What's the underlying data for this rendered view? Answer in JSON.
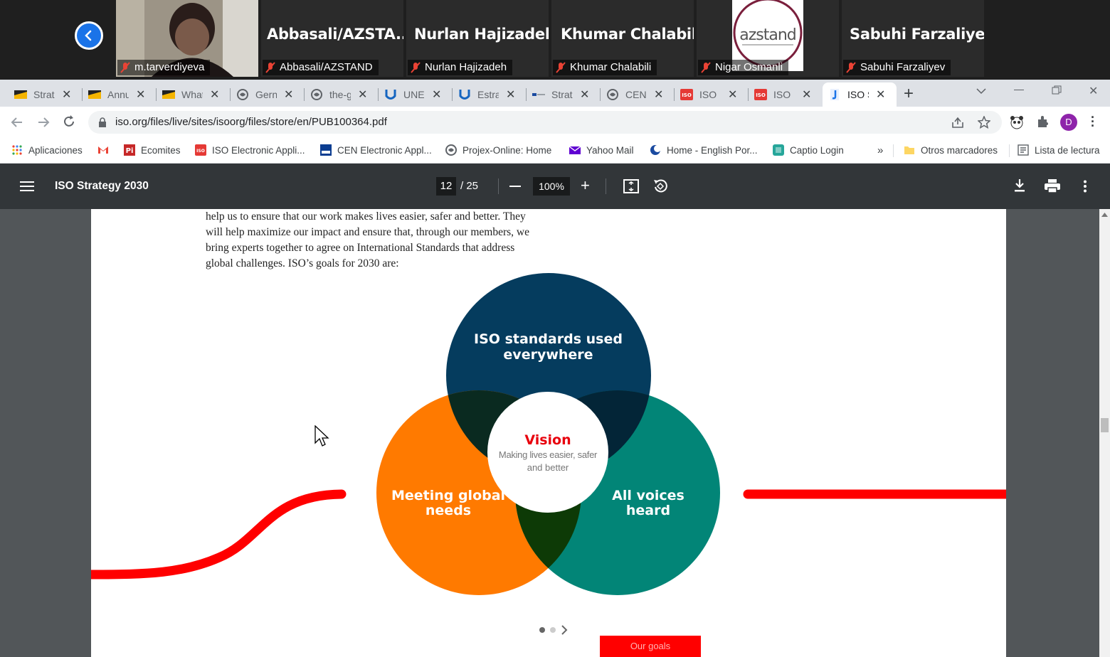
{
  "meeting": {
    "participants": [
      {
        "label": "m.tarverdiyeva",
        "display_name": ""
      },
      {
        "label": "Abbasali/AZSTAND",
        "display_name": "Abbasali/AZSTA..."
      },
      {
        "label": "Nurlan Hajizadeh",
        "display_name": "Nurlan Hajizadeh"
      },
      {
        "label": "Khumar Chalabili",
        "display_name": "Khumar Chalabili"
      },
      {
        "label": "Nigar Osmanli",
        "display_name": ""
      },
      {
        "label": "Sabuhi Farzaliyev",
        "display_name": "Sabuhi Farzaliyev"
      }
    ],
    "logo_text": "azstand"
  },
  "tabs": [
    {
      "title": "Strat",
      "icon": "folder-doc-icon"
    },
    {
      "title": "Annu",
      "icon": "folder-doc-icon"
    },
    {
      "title": "What",
      "icon": "folder-doc-icon"
    },
    {
      "title": "Gern",
      "icon": "globe-icon"
    },
    {
      "title": "the-g",
      "icon": "globe-icon"
    },
    {
      "title": "UNE",
      "icon": "une-icon"
    },
    {
      "title": "Estra",
      "icon": "une-icon"
    },
    {
      "title": "Strat",
      "icon": "dash-icon"
    },
    {
      "title": "CEN",
      "icon": "globe-icon"
    },
    {
      "title": "ISO",
      "icon": "iso-icon"
    },
    {
      "title": "ISO",
      "icon": "iso-icon"
    },
    {
      "title": "ISO S",
      "icon": "j-icon"
    }
  ],
  "address_bar": {
    "url": "iso.org/files/live/sites/isoorg/files/store/en/PUB100364.pdf"
  },
  "profile_initial": "D",
  "bookmarks": [
    {
      "label": "Aplicaciones",
      "icon": "apps-grid-icon"
    },
    {
      "label": "",
      "icon": "gmail-icon"
    },
    {
      "label": "Ecomites",
      "icon": "pi-icon"
    },
    {
      "label": "ISO Electronic Appli...",
      "icon": "iso-icon"
    },
    {
      "label": "CEN Electronic Appl...",
      "icon": "cen-icon"
    },
    {
      "label": "Projex-Online: Home",
      "icon": "globe-icon"
    },
    {
      "label": "Yahoo Mail",
      "icon": "mail-icon"
    },
    {
      "label": "Home - English Por...",
      "icon": "moon-icon"
    },
    {
      "label": "Captio Login",
      "icon": "captio-icon"
    }
  ],
  "bookmarks_overflow": "»",
  "other_bookmarks": "Otros marcadores",
  "reading_list": "Lista de lectura",
  "pdf": {
    "title": "ISO Strategy 2030",
    "page_current": "12",
    "page_total": "/ 25",
    "zoom": "100%"
  },
  "document": {
    "paragraph": [
      "help us to ensure that our work makes lives easier, safer and better. They",
      "will help maximize our impact and ensure that, through our members, we",
      "bring experts together to agree on International Standards that address",
      "global challenges. ISO’s goals for 2030 are:"
    ],
    "venn": {
      "top_line1": "ISO standards used",
      "top_line2": "everywhere",
      "left_line1": "Meeting global",
      "left_line2": "needs",
      "right_line1": "All voices",
      "right_line2": "heard",
      "center_title": "Vision",
      "center_line1": "Making lives easier, safer",
      "center_line2": "and better"
    },
    "goals_button": "Our goals",
    "colors": {
      "top": "#053c5e",
      "left": "#ff7a00",
      "right": "#028577",
      "accent": "#ff0000"
    }
  }
}
